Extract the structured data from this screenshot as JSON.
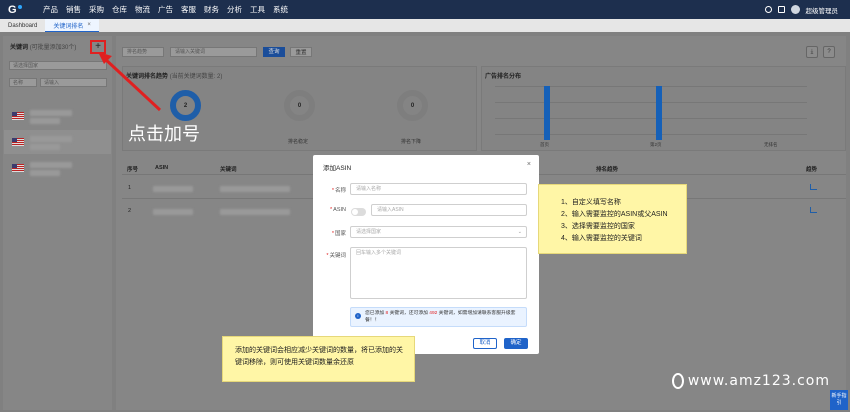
{
  "nav": {
    "logo": "G",
    "menu": [
      "产品",
      "销售",
      "采购",
      "仓库",
      "物流",
      "广告",
      "客服",
      "财务",
      "分析",
      "工具",
      "系统"
    ],
    "user": "超级管理员"
  },
  "tabs": [
    {
      "label": "Dashboard"
    },
    {
      "label": "关键词排名",
      "close": "×"
    }
  ],
  "left": {
    "title": "关键词",
    "subtitle": "(可批量添加30个)",
    "plus": "+",
    "country_placeholder": "请选择国家",
    "name_label": "名称",
    "name_placeholder": "请输入"
  },
  "main": {
    "filter_placeholder": "排名趋势",
    "keyword_placeholder": "请输入关键词",
    "search_btn": "查询",
    "reset_btn": "重置",
    "trend_card_title": "关键词排名趋势",
    "trend_card_sub": "(当前关键词数量: 2)",
    "rings": [
      {
        "value": "2",
        "label": ""
      },
      {
        "value": "0",
        "label": "排名稳定"
      },
      {
        "value": "0",
        "label": "排名下降"
      }
    ],
    "dist_card_title": "广告排名分布",
    "dist_axis": [
      "首页",
      "第2页",
      "无排名"
    ],
    "table_headers": [
      "序号",
      "ASIN",
      "关键词",
      "排名趋势",
      "趋势"
    ],
    "rows": [
      {
        "idx": "1"
      },
      {
        "idx": "2"
      }
    ]
  },
  "annotation": {
    "click_plus": "点击加号"
  },
  "modal": {
    "title": "添加ASIN",
    "close": "×",
    "name_label": "名称",
    "name_placeholder": "请输入名称",
    "asin_label": "ASIN",
    "asin_placeholder": "请输入ASIN",
    "country_label": "国家",
    "country_placeholder": "请选择国家",
    "keyword_label": "关键词",
    "keyword_placeholder": "回车输入多个关键词",
    "notice_a": "您已添加",
    "notice_used": "8",
    "notice_b": "关键词，还可添加",
    "notice_left": "492",
    "notice_c": "关键词，如需增加请联系客服升级套餐！！",
    "cancel": "取消",
    "confirm": "确定"
  },
  "callout1": [
    "1、自定义填写名称",
    "2、输入需要监控的ASIN或父ASIN",
    "3、选择需要监控的国家",
    "4、输入需要监控的关键词"
  ],
  "callout2": "添加的关键词会相应减少关键词的数量，将已添加的关键词移除，则可使用关键词数量余还原",
  "watermark": "www.amz123.com",
  "help_badge": "新手指引",
  "colors": {
    "nav": "#1d2f4e",
    "primary": "#1f63c9",
    "danger": "#e02020",
    "callout": "#fff6a6"
  }
}
